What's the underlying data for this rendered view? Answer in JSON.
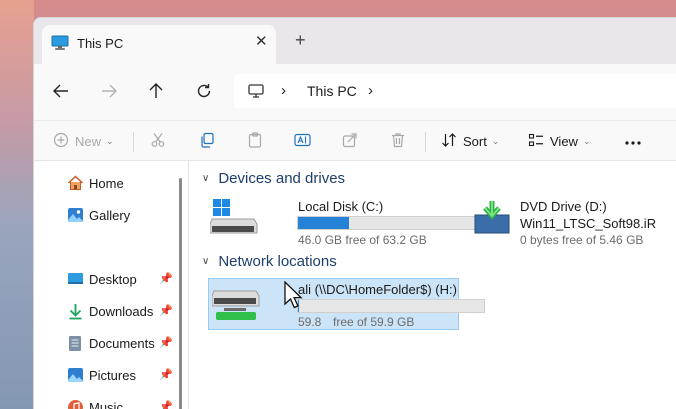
{
  "tab": {
    "title": "This PC"
  },
  "address": {
    "crumb": "This PC"
  },
  "commands": {
    "new": "New",
    "sort": "Sort",
    "view": "View"
  },
  "sidebar": {
    "items": [
      {
        "label": "Home",
        "icon": "home-icon"
      },
      {
        "label": "Gallery",
        "icon": "gallery-icon"
      },
      {
        "label": "Desktop",
        "icon": "desktop-icon",
        "pinned": true
      },
      {
        "label": "Downloads",
        "icon": "downloads-icon",
        "pinned": true
      },
      {
        "label": "Documents",
        "icon": "documents-icon",
        "pinned": true
      },
      {
        "label": "Pictures",
        "icon": "pictures-icon",
        "pinned": true
      },
      {
        "label": "Music",
        "icon": "music-icon",
        "pinned": true
      }
    ]
  },
  "groups": {
    "devices": "Devices and drives",
    "network": "Network locations"
  },
  "drives": [
    {
      "name": "Local Disk (C:)",
      "free": "46.0 GB free of 63.2 GB",
      "used_fraction": 0.27
    },
    {
      "name": "DVD Drive (D:)",
      "volume": "Win11_LTSC_Soft98.iR",
      "free": "0 bytes free of 5.46 GB"
    }
  ],
  "network": [
    {
      "name": "ali (\\\\DC\\HomeFolder$) (H:)",
      "free_start": "59.8",
      "free_end": "free of 59.9 GB",
      "used_fraction": 0.002
    }
  ],
  "colors": {
    "accent": "#2682d6",
    "selection": "#cce4f7",
    "group_header": "#1d3f6b"
  }
}
